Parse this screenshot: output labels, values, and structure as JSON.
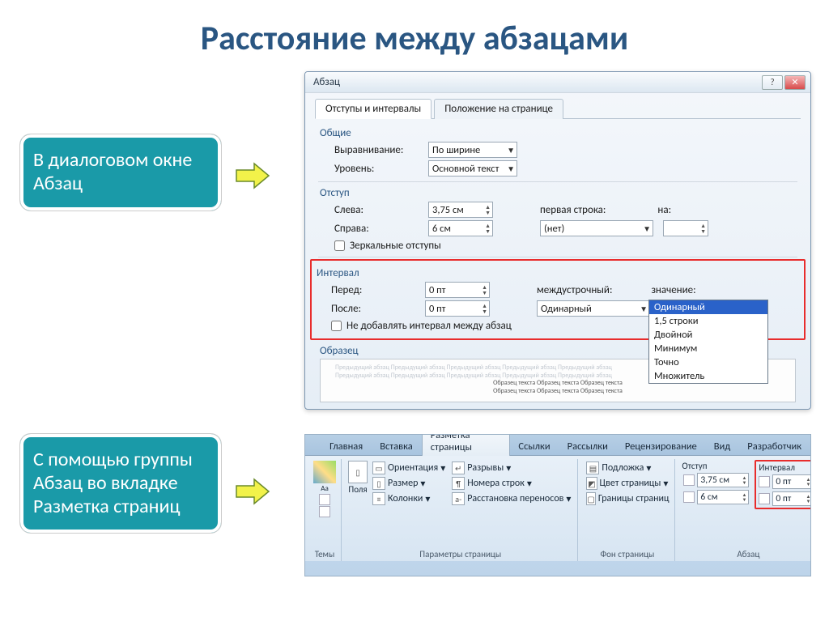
{
  "title": "Расстояние между абзацами",
  "infobox1": "В  диалоговом окне Абзац",
  "infobox2": "С помощью группы Абзац во вкладке Разметка страниц",
  "dialog": {
    "title": "Абзац",
    "tab1": "Отступы и интервалы",
    "tab2": "Положение на странице",
    "general_heading": "Общие",
    "alignment_label": "Выравнивание:",
    "alignment_value": "По ширине",
    "level_label": "Уровень:",
    "level_value": "Основной текст",
    "indent_heading": "Отступ",
    "left_label": "Слева:",
    "left_value": "3,75 см",
    "right_label": "Справа:",
    "right_value": "6 см",
    "first_line_label": "первая строка:",
    "first_line_value": "(нет)",
    "by_label": "на:",
    "mirror_chk": "Зеркальные отступы",
    "interval_heading": "Интервал",
    "before_label": "Перед:",
    "before_value": "0 пт",
    "after_label": "После:",
    "after_value": "0 пт",
    "line_spacing_label": "междустрочный:",
    "line_spacing_value": "Одинарный",
    "value_label": "значение:",
    "noadd_chk": "Не добавлять интервал между абзац",
    "sample_heading": "Образец",
    "dropdown": {
      "opt1": "Одинарный",
      "opt2": "1,5 строки",
      "opt3": "Двойной",
      "opt4": "Минимум",
      "opt5": "Точно",
      "opt6": "Множитель"
    },
    "sample_line1": "Образец текста Образец текста Образец текста"
  },
  "ribbon": {
    "tab_home": "Главная",
    "tab_insert": "Вставка",
    "tab_layout": "Разметка страницы",
    "tab_refs": "Ссылки",
    "tab_mail": "Рассылки",
    "tab_review": "Рецензирование",
    "tab_view": "Вид",
    "tab_dev": "Разработчик",
    "grp_themes": "Темы",
    "grp_pagesetup": "Параметры страницы",
    "grp_pagebg": "Фон страницы",
    "grp_indent_lbl": "Отступ",
    "grp_interval_lbl": "Интервал",
    "grp_para": "Абзац",
    "fields": "Поля",
    "orientation": "Ориентация",
    "size": "Размер",
    "columns": "Колонки",
    "breaks": "Разрывы",
    "linenums": "Номера строк",
    "hyphen": "Расстановка переносов",
    "watermark": "Подложка",
    "pagecolor": "Цвет страницы",
    "pageborders": "Границы страниц",
    "indent_left": "3,75 см",
    "indent_right": "6 см",
    "spacing_before": "0 пт",
    "spacing_after": "0 пт"
  }
}
